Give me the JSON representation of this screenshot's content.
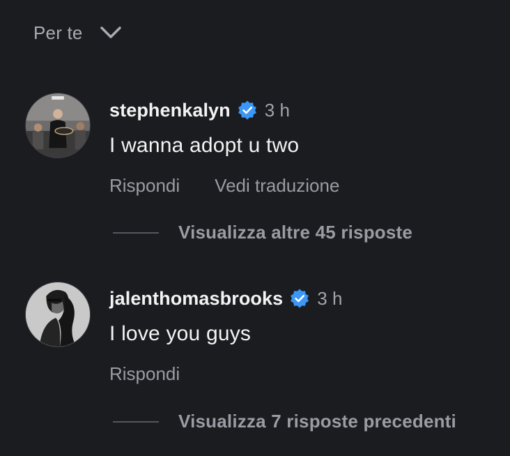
{
  "header": {
    "filter_label": "Per te",
    "chevron_icon": "chevron-down-icon"
  },
  "comments": [
    {
      "username": "stephenkalyn",
      "verified": true,
      "time": "3 h",
      "text": "I wanna adopt u two",
      "actions": [
        "Rispondi",
        "Vedi traduzione"
      ],
      "replies_label": "Visualizza altre 45 risposte"
    },
    {
      "username": "jalenthomasbrooks",
      "verified": true,
      "time": "3 h",
      "text": "I love you guys",
      "actions": [
        "Rispondi"
      ],
      "replies_label": "Visualizza 7 risposte precedenti"
    }
  ],
  "colors": {
    "background": "#1b1c20",
    "verified_badge": "#3b96f5",
    "secondary_text": "#9a9ca3"
  }
}
